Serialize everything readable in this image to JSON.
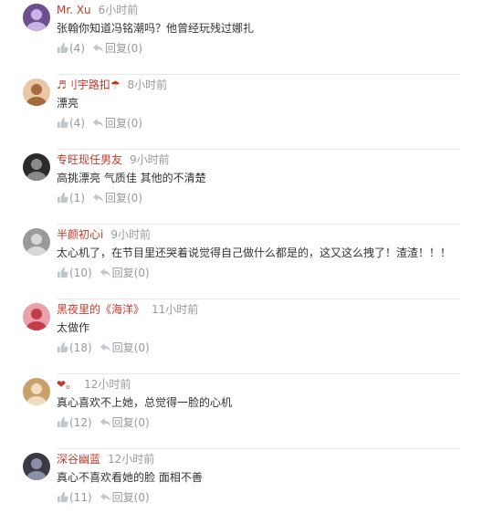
{
  "comments": [
    {
      "user": "Mr. Xu",
      "time": "6小时前",
      "text": "张翰你知道冯铭潮吗？他曾经玩残过娜扎",
      "likes": "(4)",
      "reply": "回复(0)",
      "avatar": {
        "bg": "#6b4f8f",
        "fg": "#c9b3e6"
      }
    },
    {
      "user": "♬刂宇路扣☂",
      "time": "8小时前",
      "text": "漂亮",
      "likes": "(4)",
      "reply": "回复(0)",
      "avatar": {
        "bg": "#e8c7a6",
        "fg": "#a56a3c"
      }
    },
    {
      "user": "专旺现任男友",
      "time": "9小时前",
      "text": "高挑漂亮 气质佳 其他的不清楚",
      "likes": "(1)",
      "reply": "回复(0)",
      "avatar": {
        "bg": "#2b2b2b",
        "fg": "#8a8a8a"
      }
    },
    {
      "user": "半颜初心i",
      "time": "9小时前",
      "text": "太心机了，在节目里还哭着说觉得自己做什么都是的，这又这么拽了！渣渣！！！",
      "likes": "(10)",
      "reply": "回复(0)",
      "avatar": {
        "bg": "#9a9a9a",
        "fg": "#d8d8d8"
      }
    },
    {
      "user": "黑夜里的《海洋》",
      "time": "11小时前",
      "text": "太做作",
      "likes": "(18)",
      "reply": "回复(0)",
      "avatar": {
        "bg": "#e9a0a8",
        "fg": "#c23c4c"
      }
    },
    {
      "user": "❤。",
      "time": "12小时前",
      "text": "真心喜欢不上她，总觉得一脸的心机",
      "likes": "(12)",
      "reply": "回复(0)",
      "avatar": {
        "bg": "#c8a06a",
        "fg": "#f0dcc0"
      }
    },
    {
      "user": "深谷幽蓝",
      "time": "12小时前",
      "text": "真心不喜欢看她的脸 面相不善",
      "likes": "(11)",
      "reply": "回复(0)",
      "avatar": {
        "bg": "#3a3a46",
        "fg": "#8b8fa8"
      }
    }
  ]
}
